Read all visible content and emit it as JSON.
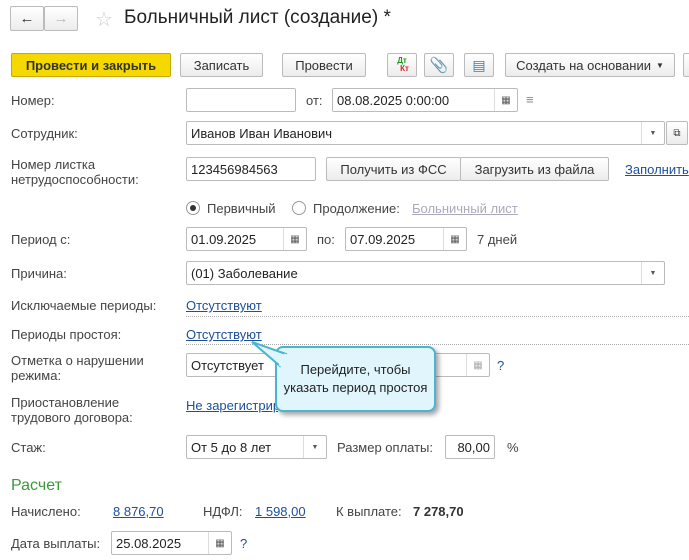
{
  "window": {
    "title": "Больничный лист (создание) *",
    "back_icon": "arrow-left",
    "forward_icon": "arrow-right",
    "favorite_icon": "star"
  },
  "toolbar": {
    "post_close": "Провести и закрыть",
    "save": "Записать",
    "post": "Провести",
    "dtkt_dt": "Дт",
    "dtkt_kt": "Кт",
    "create_based": "Создать на основании",
    "accent": "#f5d800"
  },
  "form": {
    "number_label": "Номер:",
    "number_value": "",
    "date_label": "от:",
    "date_value": "08.08.2025  0:00:00",
    "employee_label": "Сотрудник:",
    "employee_value": "Иванов Иван Иванович",
    "sheet_label": "Номер листка нетрудоспособности:",
    "sheet_value": "123456984563",
    "get_fss": "Получить из ФСС",
    "load_file": "Загрузить из файла",
    "fill": "Заполнить",
    "primary": "Первичный",
    "continuation": "Продолжение:",
    "continuation_link": "Больничный лист",
    "period_label": "Период с:",
    "period_from": "01.09.2025",
    "period_to_label": "по:",
    "period_to": "07.09.2025",
    "days": "7 дней",
    "reason_label": "Причина:",
    "reason_value": "(01) Заболевание",
    "excluded_label": "Исключаемые периоды:",
    "excluded_value": "Отсутствуют",
    "idle_label": "Периоды простоя:",
    "idle_value": "Отсутствуют",
    "violation_label": "Отметка о нарушении режима:",
    "violation_value": "Отсутствует",
    "help": "?",
    "suspension_label": "Приостановление трудового договора:",
    "suspension_value": "Не зарегистрировано",
    "experience_label": "Стаж:",
    "experience_value": "От 5 до 8 лет",
    "pay_label": "Размер оплаты:",
    "pay_value": "80,00",
    "pay_unit": "%"
  },
  "calc": {
    "title": "Расчет",
    "accrued_label": "Начислено:",
    "accrued_value": "8 876,70",
    "ndfl_label": "НДФЛ:",
    "ndfl_value": "1 598,00",
    "topay_label": "К выплате:",
    "topay_value": "7 278,70",
    "paydate_label": "Дата выплаты:",
    "paydate_value": "25.08.2025",
    "help": "?"
  },
  "tooltip": {
    "text": "Перейдите, чтобы указать период простоя"
  }
}
